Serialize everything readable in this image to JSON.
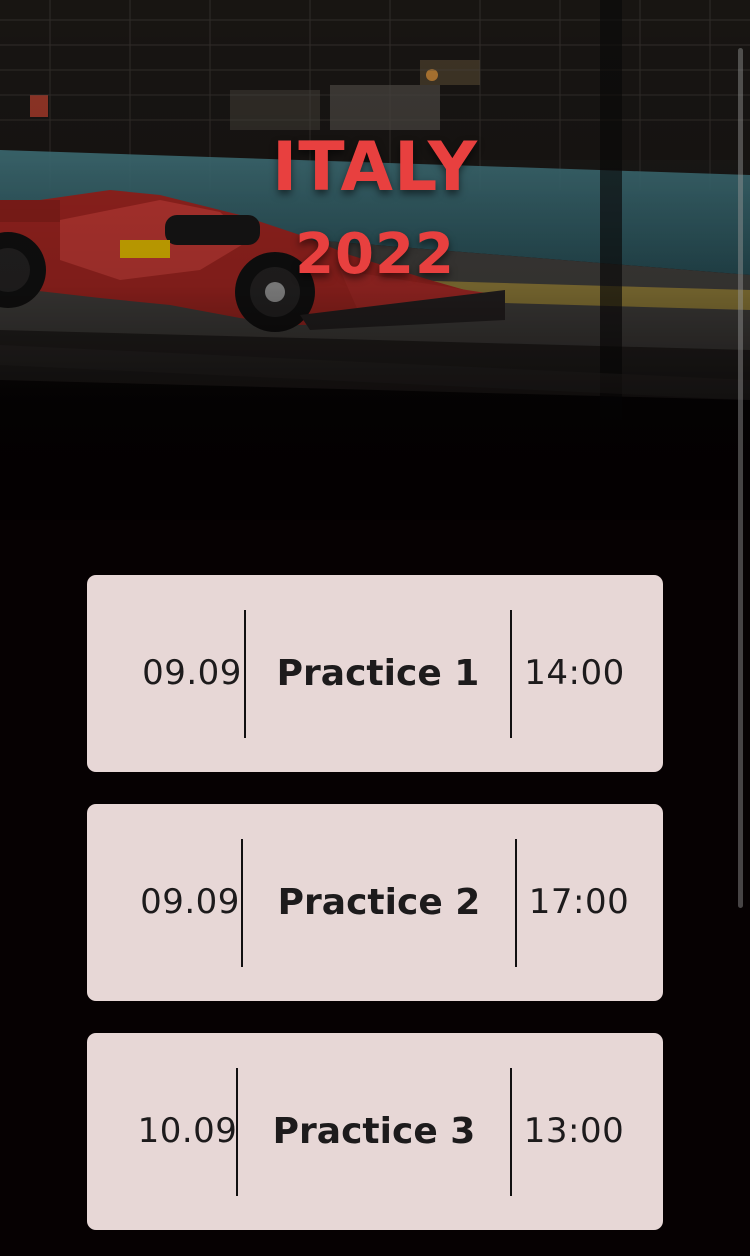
{
  "hero": {
    "country": "ITALY",
    "year": "2022",
    "accent_color": "#e8403f",
    "image": "ferrari-f1-car-night-race"
  },
  "sessions": [
    {
      "date": "09.09",
      "name": "Practice 1",
      "time": "14:00"
    },
    {
      "date": "09.09",
      "name": "Practice 2",
      "time": "17:00"
    },
    {
      "date": "10.09",
      "name": "Practice 3",
      "time": "13:00"
    }
  ],
  "colors": {
    "background": "#060102",
    "card": "#e7d7d6",
    "card_text": "#1d1b1c"
  }
}
